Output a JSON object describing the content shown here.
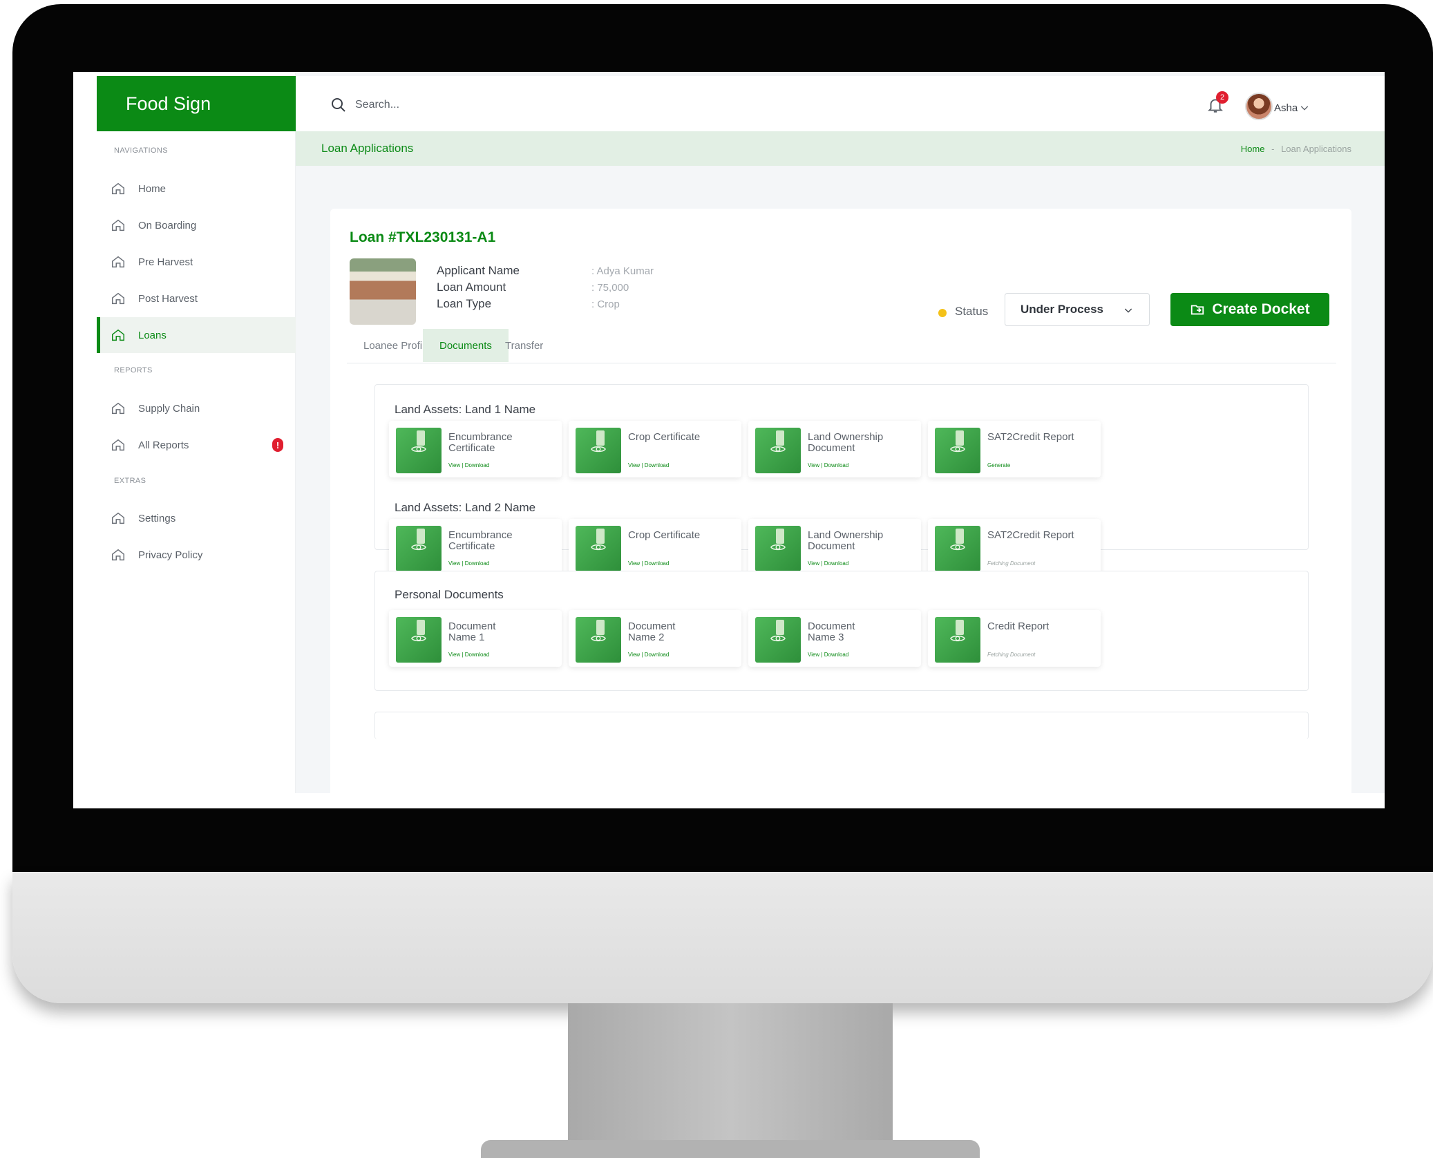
{
  "brand": "Food Sign",
  "search": {
    "placeholder": "Search..."
  },
  "notifications": {
    "count": "2"
  },
  "user": {
    "name": "Asha"
  },
  "sidebar": {
    "section_navigations": "NAVIGATIONS",
    "section_reports": "REPORTS",
    "section_extras": "EXTRAS",
    "items": [
      {
        "label": "Home"
      },
      {
        "label": "On Boarding"
      },
      {
        "label": "Pre Harvest"
      },
      {
        "label": "Post Harvest"
      },
      {
        "label": "Loans"
      },
      {
        "label": "Supply Chain"
      },
      {
        "label": "All Reports",
        "badge": "!"
      },
      {
        "label": "Settings"
      },
      {
        "label": "Privacy Policy"
      }
    ]
  },
  "breadcrumb": {
    "title": "Loan Applications",
    "home": "Home",
    "separator": "-",
    "current": "Loan Applications"
  },
  "loan": {
    "title": "Loan #TXL230131-A1",
    "fields": [
      {
        "label": "Applicant Name",
        "value": "Adya Kumar"
      },
      {
        "label": "Loan Amount",
        "value": "75,000"
      },
      {
        "label": "Loan Type",
        "value": "Crop"
      }
    ],
    "status_label": "Status",
    "status_value": "Under Process",
    "create_button": "Create Docket"
  },
  "tabs": [
    {
      "label": "Loanee Profile"
    },
    {
      "label": "Documents",
      "active": true
    },
    {
      "label": "Transfer"
    }
  ],
  "documents": {
    "land1": {
      "title": "Land Assets: Land 1 Name",
      "cards": [
        {
          "name": "Encumbrance Certificate",
          "action": "View | Download"
        },
        {
          "name": "Crop Certificate",
          "action": "View | Download"
        },
        {
          "name": "Land Ownership Document",
          "action": "View | Download"
        },
        {
          "name": "SAT2Credit Report",
          "action": "Generate"
        }
      ]
    },
    "land2": {
      "title": "Land Assets: Land 2 Name",
      "cards": [
        {
          "name": "Encumbrance Certificate",
          "action": "View | Download"
        },
        {
          "name": "Crop Certificate",
          "action": "View | Download"
        },
        {
          "name": "Land Ownership Document",
          "action": "View | Download"
        },
        {
          "name": "SAT2Credit Report",
          "action": "Fetching Document"
        }
      ]
    },
    "personal": {
      "title": "Personal Documents",
      "cards": [
        {
          "name": "Document Name 1",
          "action": "View | Download"
        },
        {
          "name": "Document Name 2",
          "action": "View | Download"
        },
        {
          "name": "Document Name 3",
          "action": "View | Download"
        },
        {
          "name": "Credit Report",
          "action": "Fetching Document"
        }
      ]
    }
  },
  "colors": {
    "brand": "#0b8a15",
    "alert": "#e01e2f",
    "status": "#f4c21a"
  }
}
